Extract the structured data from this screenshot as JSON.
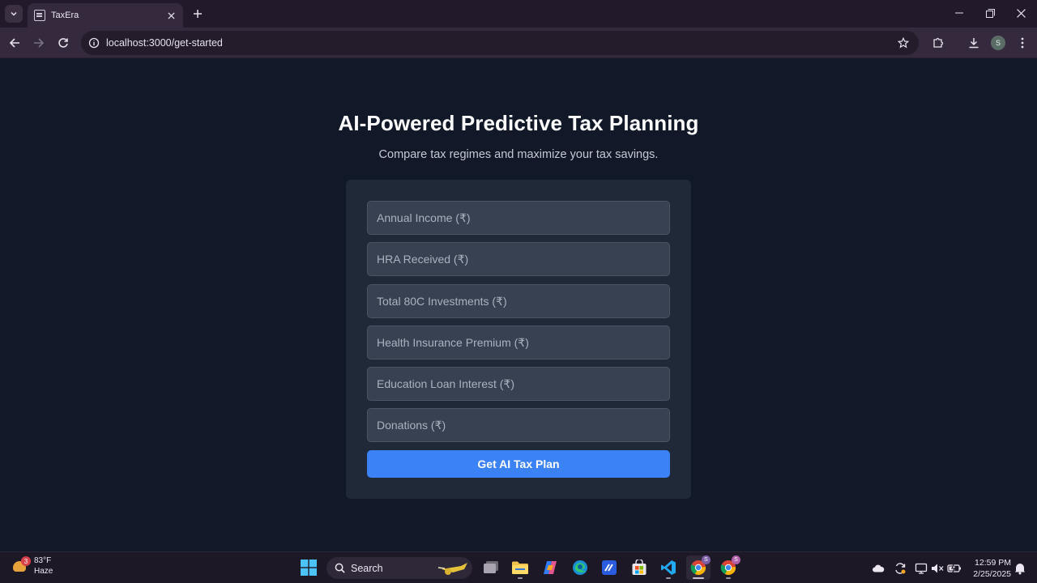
{
  "browser": {
    "tab_title": "TaxEra",
    "url": "localhost:3000/get-started",
    "profile_initial": "S"
  },
  "page": {
    "title": "AI-Powered Predictive Tax Planning",
    "subtitle": "Compare tax regimes and maximize your tax savings.",
    "fields": [
      {
        "placeholder": "Annual Income (₹)",
        "value": ""
      },
      {
        "placeholder": "HRA Received (₹)",
        "value": ""
      },
      {
        "placeholder": "Total 80C Investments (₹)",
        "value": ""
      },
      {
        "placeholder": "Health Insurance Premium (₹)",
        "value": ""
      },
      {
        "placeholder": "Education Loan Interest (₹)",
        "value": ""
      },
      {
        "placeholder": "Donations (₹)",
        "value": ""
      }
    ],
    "submit_label": "Get AI Tax Plan",
    "colors": {
      "background": "#111827",
      "card": "#1f2937",
      "input": "#374151",
      "accent": "#3b82f6"
    }
  },
  "taskbar": {
    "weather_temp": "83°F",
    "weather_desc": "Haze",
    "weather_badge": "3",
    "search_label": "Search",
    "chrome_badge": "S",
    "chrome2_badge": "S",
    "time": "12:59 PM",
    "date": "2/25/2025",
    "pinned_apps": [
      "windows-start",
      "search",
      "task-view",
      "file-explorer",
      "copilot",
      "edge",
      "vscode-insiders",
      "microsoft-store",
      "vscode",
      "chrome",
      "chrome-profile-2"
    ]
  }
}
